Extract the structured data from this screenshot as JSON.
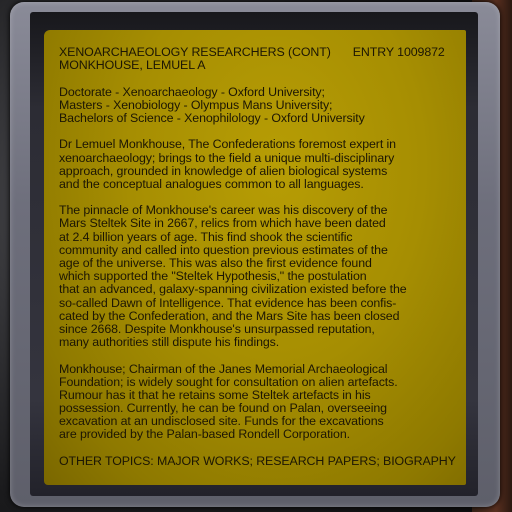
{
  "header": {
    "section": "XENOARCHAEOLOGY RESEARCHERS (CONT)",
    "entry": "ENTRY 1009872",
    "name": "MONKHOUSE, LEMUEL A"
  },
  "education": [
    "Doctorate - Xenoarchaeology - Oxford University;",
    "Masters - Xenobiology - Olympus Mans University;",
    "Bachelors of Science - Xenophilology - Oxford University"
  ],
  "paragraphs": [
    [
      "Dr Lemuel Monkhouse, The Confederations foremost expert in",
      "xenoarchaeology; brings to the field a unique multi-disciplinary",
      "approach, grounded in knowledge of alien biological systems",
      "and the conceptual analogues common to all languages."
    ],
    [
      "The pinnacle of Monkhouse's career was his discovery of the",
      "Mars Steltek Site in 2667, relics from which have been dated",
      "at 2.4 billion years of age. This find shook the scientific",
      "community and called into question previous estimates of the",
      "age of the universe. This was also the first evidence found",
      "which supported the \"Steltek Hypothesis,\" the postulation",
      "that an advanced, galaxy-spanning civilization existed before the",
      "so-called Dawn of Intelligence. That evidence has been confis-",
      "cated by the Confederation, and the Mars Site has been closed",
      "since 2668. Despite Monkhouse's unsurpassed reputation,",
      "many authorities still dispute his findings."
    ],
    [
      "Monkhouse; Chairman of the Janes Memorial Archaeological",
      "Foundation; is widely sought for consultation on alien artefacts.",
      "Rumour has it that he retains some Steltek artefacts in his",
      "possession. Currently, he can be found on Palan, overseeing",
      "excavation at an undisclosed site. Funds for the excavations",
      "are provided by the Palan-based Rondell Corporation."
    ]
  ],
  "other_topics": {
    "label": "OTHER TOPICS: ",
    "topics": [
      "MAJOR WORKS",
      "RESEARCH PAPERS",
      "BIOGRAPHY"
    ],
    "separator": "; "
  },
  "colors": {
    "screen": "#a68e02",
    "text": "#1c1604",
    "bezel": "#7a7b88"
  }
}
